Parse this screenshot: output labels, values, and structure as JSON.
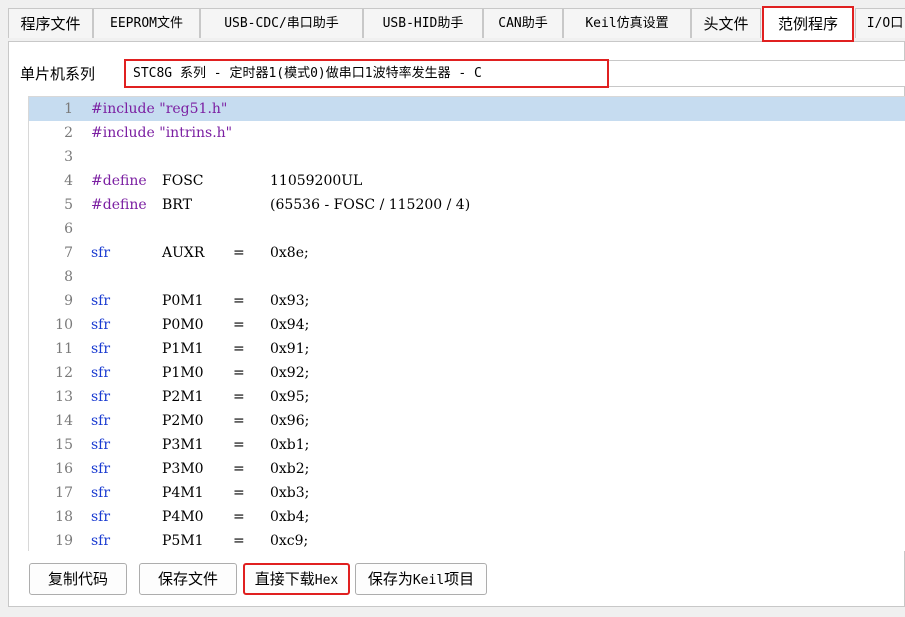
{
  "tabs": [
    {
      "label": "程序文件"
    },
    {
      "label": "EEPROM文件"
    },
    {
      "label": "USB-CDC/串口助手"
    },
    {
      "label": "USB-HID助手"
    },
    {
      "label": "CAN助手"
    },
    {
      "label": "Keil仿真设置"
    },
    {
      "label": "头文件"
    },
    {
      "label": "范例程序"
    },
    {
      "label": "I/O口"
    }
  ],
  "series": {
    "label": "单片机系列",
    "selected": "STC8G 系列 - 定时器1(模式0)做串口1波特率发生器 - C"
  },
  "code_lines": [
    {
      "n": "1",
      "a": "#include \"reg51.h\"",
      "b": "",
      "c": "",
      "d": ""
    },
    {
      "n": "2",
      "a": "#include \"intrins.h\"",
      "b": "",
      "c": "",
      "d": ""
    },
    {
      "n": "3",
      "a": "",
      "b": "",
      "c": "",
      "d": ""
    },
    {
      "n": "4",
      "a": "#define",
      "b": "FOSC",
      "c": "",
      "d": "11059200UL"
    },
    {
      "n": "5",
      "a": "#define",
      "b": "BRT",
      "c": "",
      "d": "(65536 - FOSC / 115200 / 4)"
    },
    {
      "n": "6",
      "a": "",
      "b": "",
      "c": "",
      "d": ""
    },
    {
      "n": "7",
      "a": "sfr",
      "b": "AUXR",
      "c": "=",
      "d": "0x8e;"
    },
    {
      "n": "8",
      "a": "",
      "b": "",
      "c": "",
      "d": ""
    },
    {
      "n": "9",
      "a": "sfr",
      "b": "P0M1",
      "c": "=",
      "d": "0x93;"
    },
    {
      "n": "10",
      "a": "sfr",
      "b": "P0M0",
      "c": "=",
      "d": "0x94;"
    },
    {
      "n": "11",
      "a": "sfr",
      "b": "P1M1",
      "c": "=",
      "d": "0x91;"
    },
    {
      "n": "12",
      "a": "sfr",
      "b": "P1M0",
      "c": "=",
      "d": "0x92;"
    },
    {
      "n": "13",
      "a": "sfr",
      "b": "P2M1",
      "c": "=",
      "d": "0x95;"
    },
    {
      "n": "14",
      "a": "sfr",
      "b": "P2M0",
      "c": "=",
      "d": "0x96;"
    },
    {
      "n": "15",
      "a": "sfr",
      "b": "P3M1",
      "c": "=",
      "d": "0xb1;"
    },
    {
      "n": "16",
      "a": "sfr",
      "b": "P3M0",
      "c": "=",
      "d": "0xb2;"
    },
    {
      "n": "17",
      "a": "sfr",
      "b": "P4M1",
      "c": "=",
      "d": "0xb3;"
    },
    {
      "n": "18",
      "a": "sfr",
      "b": "P4M0",
      "c": "=",
      "d": "0xb4;"
    },
    {
      "n": "19",
      "a": "sfr",
      "b": "P5M1",
      "c": "=",
      "d": "0xc9;"
    }
  ],
  "buttons": {
    "copy": "复制代码",
    "save": "保存文件",
    "download_prefix": "直接下载",
    "download_suffix": "Hex",
    "keil_prefix": "保存为",
    "keil_mono": "Keil",
    "keil_suffix": "项目"
  },
  "colors": {
    "highlight": "#e02020",
    "preprocessor": "#7b1fa2",
    "keyword": "#1a3bd1",
    "selected_line": "#c6dcf0"
  }
}
